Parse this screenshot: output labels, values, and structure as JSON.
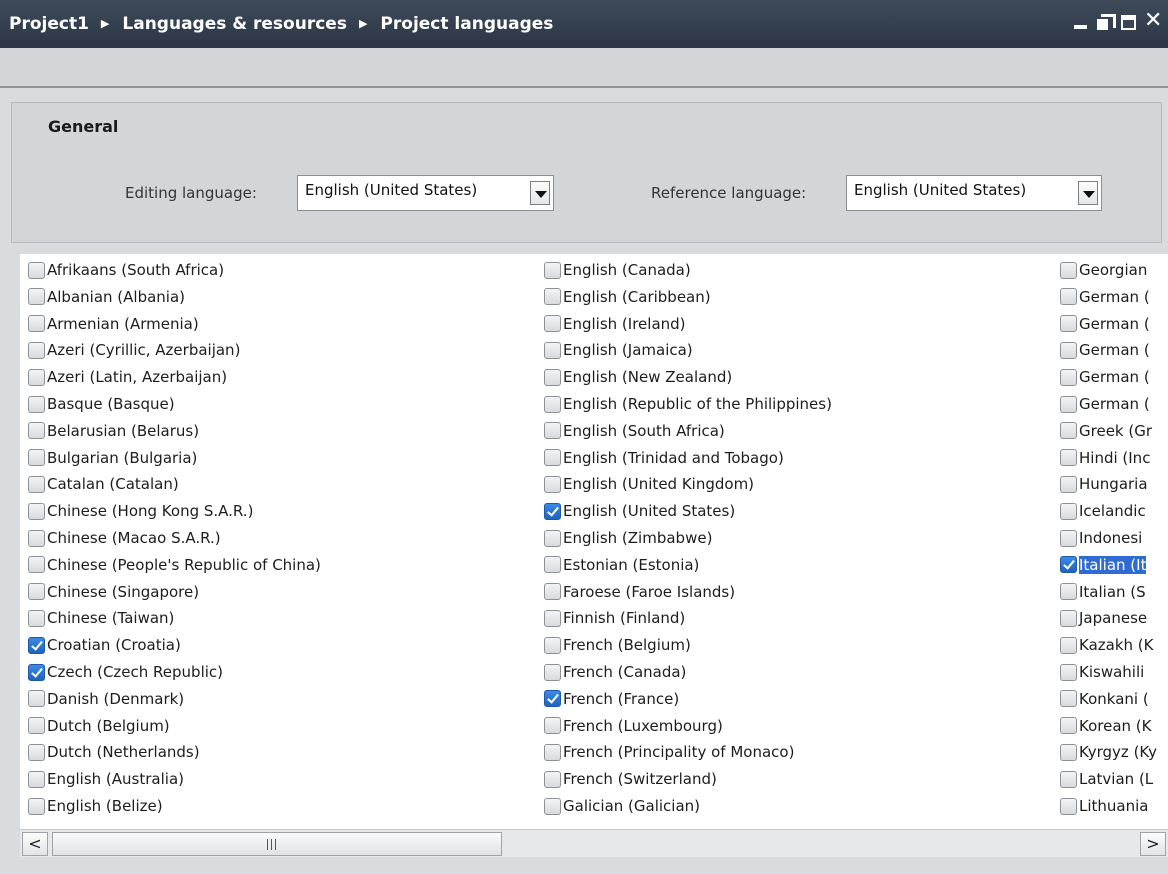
{
  "title_bar": {
    "breadcrumbs": [
      "Project1",
      "Languages & resources",
      "Project languages"
    ],
    "separator_icon": "triangle-right-icon",
    "window_controls": [
      "minimize-icon",
      "restore-icon",
      "maximize-icon",
      "close-icon"
    ]
  },
  "general": {
    "title": "General",
    "editing_label": "Editing language:",
    "editing_value": "English (United States)",
    "reference_label": "Reference language:",
    "reference_value": "English (United States)"
  },
  "languages": {
    "columns": [
      [
        {
          "label": "Afrikaans (South Africa)",
          "checked": false
        },
        {
          "label": "Albanian (Albania)",
          "checked": false
        },
        {
          "label": "Armenian (Armenia)",
          "checked": false
        },
        {
          "label": "Azeri (Cyrillic, Azerbaijan)",
          "checked": false
        },
        {
          "label": "Azeri (Latin, Azerbaijan)",
          "checked": false
        },
        {
          "label": "Basque (Basque)",
          "checked": false
        },
        {
          "label": "Belarusian (Belarus)",
          "checked": false
        },
        {
          "label": "Bulgarian (Bulgaria)",
          "checked": false
        },
        {
          "label": "Catalan (Catalan)",
          "checked": false
        },
        {
          "label": "Chinese (Hong Kong S.A.R.)",
          "checked": false
        },
        {
          "label": "Chinese (Macao S.A.R.)",
          "checked": false
        },
        {
          "label": "Chinese (People's Republic of China)",
          "checked": false
        },
        {
          "label": "Chinese (Singapore)",
          "checked": false
        },
        {
          "label": "Chinese (Taiwan)",
          "checked": false
        },
        {
          "label": "Croatian (Croatia)",
          "checked": true
        },
        {
          "label": "Czech (Czech Republic)",
          "checked": true
        },
        {
          "label": "Danish (Denmark)",
          "checked": false
        },
        {
          "label": "Dutch (Belgium)",
          "checked": false
        },
        {
          "label": "Dutch (Netherlands)",
          "checked": false
        },
        {
          "label": "English (Australia)",
          "checked": false
        },
        {
          "label": "English (Belize)",
          "checked": false
        }
      ],
      [
        {
          "label": "English (Canada)",
          "checked": false
        },
        {
          "label": "English (Caribbean)",
          "checked": false
        },
        {
          "label": "English (Ireland)",
          "checked": false
        },
        {
          "label": "English (Jamaica)",
          "checked": false
        },
        {
          "label": "English (New Zealand)",
          "checked": false
        },
        {
          "label": "English (Republic of the Philippines)",
          "checked": false
        },
        {
          "label": "English (South Africa)",
          "checked": false
        },
        {
          "label": "English (Trinidad and Tobago)",
          "checked": false
        },
        {
          "label": "English (United Kingdom)",
          "checked": false
        },
        {
          "label": "English (United States)",
          "checked": true
        },
        {
          "label": "English (Zimbabwe)",
          "checked": false
        },
        {
          "label": "Estonian (Estonia)",
          "checked": false
        },
        {
          "label": "Faroese (Faroe Islands)",
          "checked": false
        },
        {
          "label": "Finnish (Finland)",
          "checked": false
        },
        {
          "label": "French (Belgium)",
          "checked": false
        },
        {
          "label": "French (Canada)",
          "checked": false
        },
        {
          "label": "French (France)",
          "checked": true
        },
        {
          "label": "French (Luxembourg)",
          "checked": false
        },
        {
          "label": "French (Principality of Monaco)",
          "checked": false
        },
        {
          "label": "French (Switzerland)",
          "checked": false
        },
        {
          "label": "Galician (Galician)",
          "checked": false
        }
      ],
      [
        {
          "label": "Georgian",
          "checked": false
        },
        {
          "label": "German (",
          "checked": false
        },
        {
          "label": "German (",
          "checked": false
        },
        {
          "label": "German (",
          "checked": false
        },
        {
          "label": "German (",
          "checked": false
        },
        {
          "label": "German (",
          "checked": false
        },
        {
          "label": "Greek (Gr",
          "checked": false
        },
        {
          "label": "Hindi (Inc",
          "checked": false
        },
        {
          "label": "Hungaria",
          "checked": false
        },
        {
          "label": "Icelandic",
          "checked": false
        },
        {
          "label": "Indonesi",
          "checked": false
        },
        {
          "label": "Italian (It",
          "checked": true,
          "selected": true
        },
        {
          "label": "Italian (S",
          "checked": false
        },
        {
          "label": "Japanese",
          "checked": false
        },
        {
          "label": "Kazakh (K",
          "checked": false
        },
        {
          "label": "Kiswahili",
          "checked": false
        },
        {
          "label": "Konkani (",
          "checked": false
        },
        {
          "label": "Korean (K",
          "checked": false
        },
        {
          "label": "Kyrgyz (Ky",
          "checked": false
        },
        {
          "label": "Latvian (L",
          "checked": false
        },
        {
          "label": "Lithuania",
          "checked": false
        }
      ]
    ]
  },
  "scrollbar": {
    "left_icon": "chevron-left-icon",
    "right_icon": "chevron-right-icon",
    "left_glyph": "<",
    "right_glyph": ">"
  }
}
